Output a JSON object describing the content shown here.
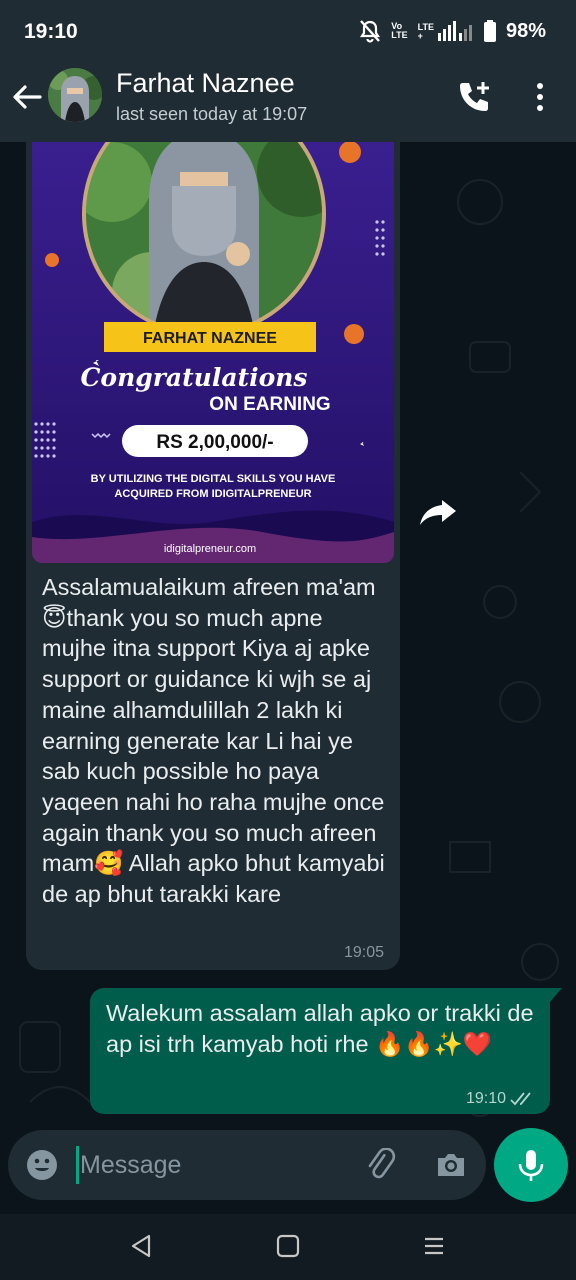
{
  "status_bar": {
    "time": "19:10",
    "network_top": "Vo",
    "network_bottom": "LTE",
    "network2_top": "LTE",
    "network2_bottom": "+",
    "battery": "98%"
  },
  "header": {
    "contact_name": "Farhat Naznee",
    "last_seen": "last seen today at 19:07"
  },
  "incoming": {
    "image": {
      "name_banner": "FARHAT NAZNEE",
      "congrats": "Congratulations",
      "on_earning": "ON EARNING",
      "amount": "RS 2,00,000/-",
      "caption_line1": "BY UTILIZING THE DIGITAL SKILLS YOU HAVE",
      "caption_line2": "ACQUIRED FROM IDIGITALPRENEUR",
      "website": "idigitalpreneur.com"
    },
    "text": "Assalamualaikum afreen ma'am 😇thank you so much apne mujhe itna support Kiya aj apke support or guidance ki wjh se aj maine alhamdulillah 2 lakh ki earning generate kar Li hai ye sab kuch possible ho paya yaqeen nahi ho raha mujhe once again thank you so much afreen mam🥰 Allah apko bhut kamyabi de ap bhut tarakki kare",
    "time": "19:05"
  },
  "outgoing": {
    "text": "Walekum assalam  allah apko or trakki de ap isi trh kamyab hoti rhe 🔥🔥✨❤️",
    "time": "19:10"
  },
  "composer": {
    "placeholder": "Message"
  },
  "colors": {
    "header": "#1f2c33",
    "background": "#0b141a",
    "incoming_bubble": "#202c33",
    "outgoing_bubble": "#005c4b",
    "accent": "#00a884"
  }
}
